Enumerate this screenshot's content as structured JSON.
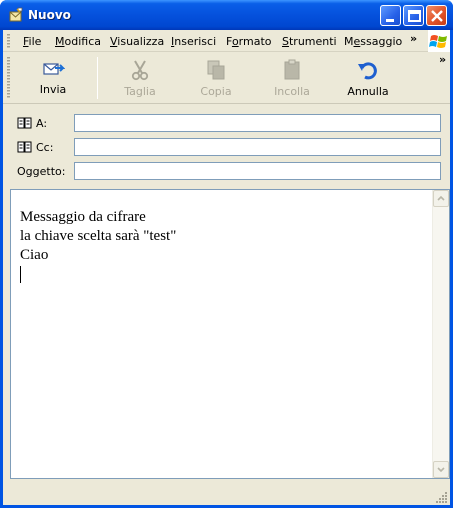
{
  "window": {
    "title": "Nuovo"
  },
  "menu": {
    "items": [
      {
        "label": "File",
        "u": "F"
      },
      {
        "label": "Modifica",
        "u": "M"
      },
      {
        "label": "Visualizza",
        "u": "V"
      },
      {
        "label": "Inserisci",
        "u": "I"
      },
      {
        "label": "Formato",
        "u": "o"
      },
      {
        "label": "Strumenti",
        "u": "S"
      },
      {
        "label": "Messaggio",
        "u": "e"
      }
    ],
    "overflow": "»"
  },
  "toolbar": {
    "buttons": [
      {
        "label": "Invia",
        "icon": "send-icon",
        "enabled": true
      },
      {
        "label": "Taglia",
        "icon": "scissors-icon",
        "enabled": false
      },
      {
        "label": "Copia",
        "icon": "copy-icon",
        "enabled": false
      },
      {
        "label": "Incolla",
        "icon": "paste-icon",
        "enabled": false
      },
      {
        "label": "Annulla",
        "icon": "undo-icon",
        "enabled": true
      }
    ],
    "overflow": "»"
  },
  "headers": {
    "to_label": "A:",
    "to_value": "",
    "cc_label": "Cc:",
    "cc_value": "",
    "subject_label": "Oggetto:",
    "subject_value": ""
  },
  "message": {
    "lines": [
      "Messaggio da cifrare",
      "la chiave scelta sarà \"test\"",
      "Ciao"
    ]
  },
  "colors": {
    "titlebar": "#0551dd",
    "window_frame": "#0054e3",
    "chrome": "#ece9d8",
    "field_border": "#7f9db9",
    "disabled_text": "#aca899"
  }
}
